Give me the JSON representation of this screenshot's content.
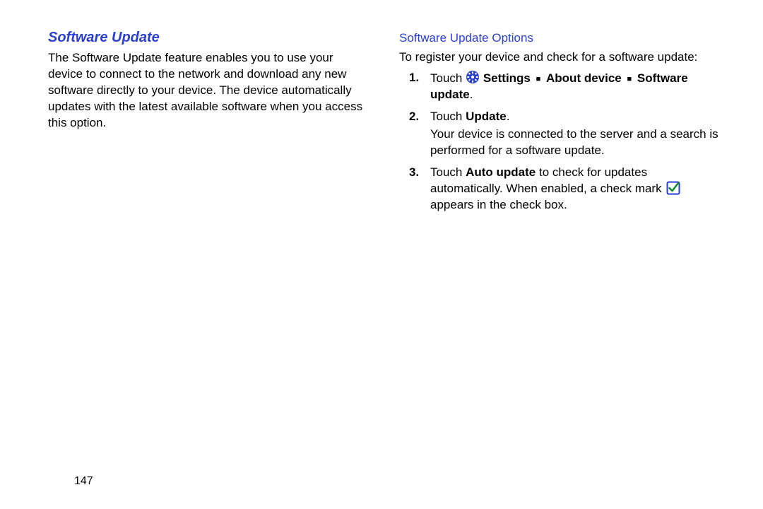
{
  "left": {
    "title": "Software Update",
    "paragraph": "The Software Update feature enables you to use your device to connect to the network and download any new software directly to your device. The device automatically updates with the latest available software when you access this option."
  },
  "right": {
    "subheading": "Software Update Options",
    "lead": "To register your device and check for a software update:",
    "step1": {
      "touch": "Touch ",
      "settings": "Settings",
      "about": "About device",
      "software": "Software update",
      "period": "."
    },
    "step2": {
      "touch": "Touch ",
      "update": "Update",
      "period": ".",
      "body": "Your device is connected to the server and a search is performed for a software update."
    },
    "step3": {
      "touch": "Touch ",
      "auto": "Auto update",
      "rest1": " to check for updates automatically. When enabled, a check mark ",
      "rest2": " appears in the check box."
    }
  },
  "pageNumber": "147"
}
